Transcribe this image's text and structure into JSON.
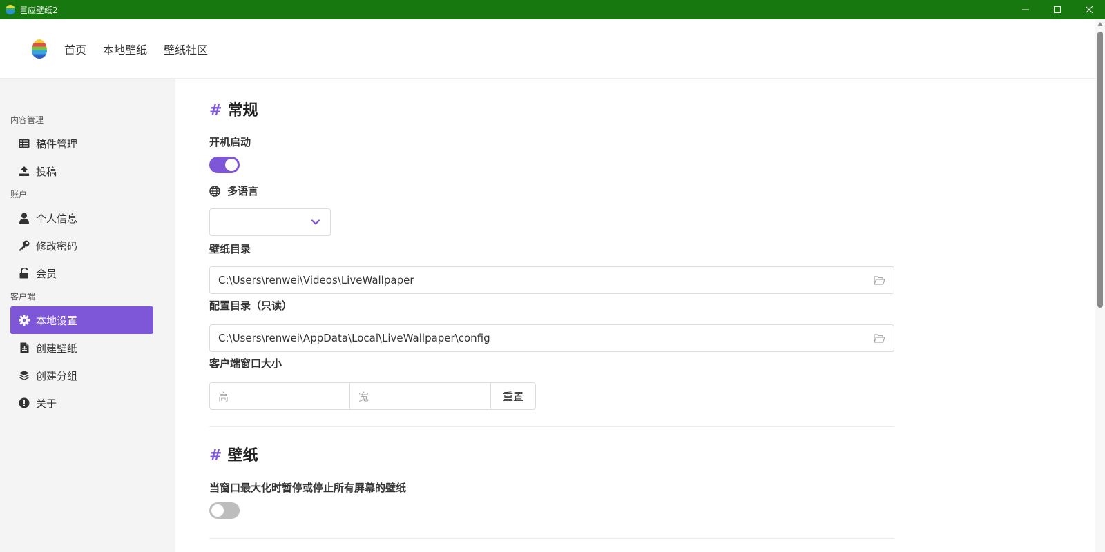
{
  "window": {
    "title": "巨应壁纸2"
  },
  "topnav": {
    "items": [
      {
        "label": "首页"
      },
      {
        "label": "本地壁纸"
      },
      {
        "label": "壁纸社区"
      }
    ]
  },
  "sidebar": {
    "sections": [
      {
        "title": "内容管理",
        "items": [
          {
            "label": "稿件管理",
            "icon": "list-icon"
          },
          {
            "label": "投稿",
            "icon": "upload-icon"
          }
        ]
      },
      {
        "title": "账户",
        "items": [
          {
            "label": "个人信息",
            "icon": "user-icon"
          },
          {
            "label": "修改密码",
            "icon": "key-icon"
          },
          {
            "label": "会员",
            "icon": "unlock-icon"
          }
        ]
      },
      {
        "title": "客户端",
        "items": [
          {
            "label": "本地设置",
            "icon": "gear-icon",
            "active": true
          },
          {
            "label": "创建壁纸",
            "icon": "file-icon"
          },
          {
            "label": "创建分组",
            "icon": "layers-icon"
          },
          {
            "label": "关于",
            "icon": "info-icon"
          }
        ]
      }
    ]
  },
  "main": {
    "general": {
      "hash": "#",
      "title": "常规",
      "autostart": {
        "label": "开机启动",
        "enabled": true
      },
      "language": {
        "label": "多语言",
        "value": ""
      },
      "wallpaper_dir": {
        "label": "壁纸目录",
        "value": "C:\\Users\\renwei\\Videos\\LiveWallpaper"
      },
      "config_dir": {
        "label": "配置目录（只读）",
        "value": "C:\\Users\\renwei\\AppData\\Local\\LiveWallpaper\\config"
      },
      "window_size": {
        "label": "客户端窗口大小",
        "height_placeholder": "高",
        "width_placeholder": "宽",
        "reset_label": "重置"
      }
    },
    "wallpaper": {
      "hash": "#",
      "title": "壁纸",
      "pause_on_maximize": {
        "label": "当窗口最大化时暂停或停止所有屏幕的壁纸",
        "enabled": false
      }
    }
  },
  "colors": {
    "titlebar": "#16780f",
    "accent": "#7e57d8",
    "sidebar_bg": "#f4f4f4"
  }
}
